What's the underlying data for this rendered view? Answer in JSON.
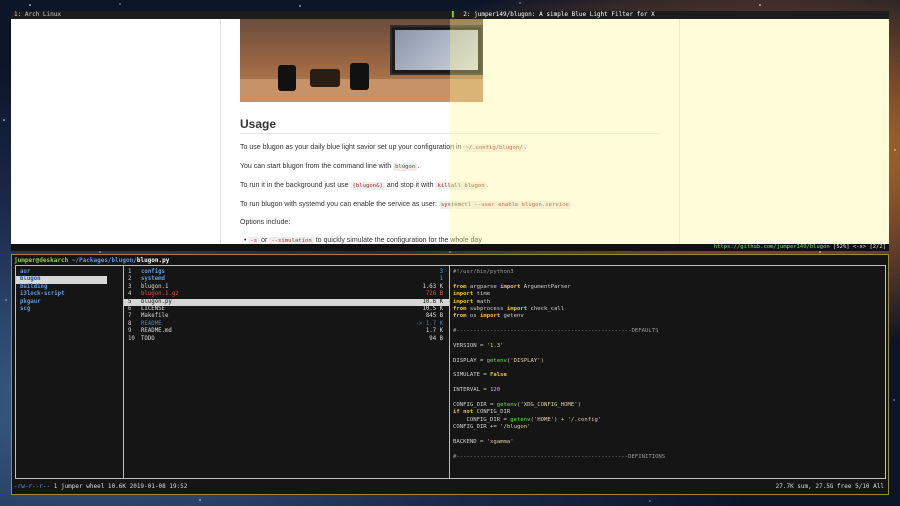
{
  "browser": {
    "tabs": [
      {
        "number": "1:",
        "title": "Arch Linux"
      },
      {
        "number": "2:",
        "title": "jumper149/blugon: A simple Blue Light Filter for X"
      }
    ],
    "page": {
      "heading": "Usage",
      "paragraphs": [
        {
          "text": "To use blugon as your daily blue light savior set up your configuration in",
          "code": "~/.config/blugon/",
          "after": "."
        },
        {
          "text": "You can start blugon from the command line with",
          "code": "blugon",
          "after": "."
        },
        {
          "text": "To run it in the background just use",
          "code": "(blugon&)",
          "after": "and stop it with",
          "code2": "killall blugon",
          "after2": "."
        },
        {
          "text": "To run blugon with systemd you can enable the service as user:",
          "code": "systemctl --user enable blugon.service",
          "after": ""
        },
        {
          "text": "Options include:"
        },
        {
          "bullet": "•",
          "code": "-s",
          "mid": "or",
          "code2": "--simulation",
          "text": "to quickly simulate the configuration for the whole day"
        }
      ]
    },
    "status": {
      "url": "https://github.com/jumper149/blugon",
      "right": "[52%] <-x> [2/2]"
    }
  },
  "terminal": {
    "path": {
      "user": "jumper@deskarch",
      "dir": "~/Packages/blugon/",
      "file": "blugon.py"
    },
    "col1": [
      "aur",
      "blugon",
      "building",
      "i3lock-script",
      "pkgaur",
      "scg"
    ],
    "col1_selected": 1,
    "col2": [
      {
        "num": "1",
        "name": "configs",
        "size": "3",
        "color": "#5f9be0",
        "bold": true
      },
      {
        "num": "2",
        "name": "systemd",
        "size": "1",
        "color": "#5f9be0",
        "bold": true
      },
      {
        "num": "3",
        "name": "blugon.1",
        "size": "1.63 K",
        "color": "#dcdcdc",
        "bold": false
      },
      {
        "num": "4",
        "name": "blugon.1.gz",
        "size": "726 B",
        "color": "#e05050",
        "bold": false
      },
      {
        "num": "5",
        "name": "blugon.py",
        "size": "10.6 K",
        "color": "#111111",
        "bold": false
      },
      {
        "num": "6",
        "name": "LICENSE",
        "size": "10.5 K",
        "color": "#dcdcdc",
        "bold": false
      },
      {
        "num": "7",
        "name": "Makefile",
        "size": "845 B",
        "color": "#dcdcdc",
        "bold": false
      },
      {
        "num": "8",
        "name": "README",
        "size": "-> 1.7 K",
        "color": "#5a7fb0",
        "bold": false
      },
      {
        "num": "9",
        "name": "README.md",
        "size": "1.7 K",
        "color": "#dcdcdc",
        "bold": false
      },
      {
        "num": "10",
        "name": "TODO",
        "size": "94 B",
        "color": "#dcdcdc",
        "bold": false
      }
    ],
    "col2_selected": 4,
    "code": {
      "shebang": "#!/usr/bin/python3",
      "imports": [
        {
          "kw1": "from",
          "mod": " argparse ",
          "kw2": "import",
          "name": " ArgumentParser"
        },
        {
          "kw1": "import",
          "mod": " time",
          "kw2": "",
          "name": ""
        },
        {
          "kw1": "import",
          "mod": " math",
          "kw2": "",
          "name": ""
        },
        {
          "kw1": "from",
          "mod": " subprocess ",
          "kw2": "import",
          "name": " check_call"
        },
        {
          "kw1": "from",
          "mod": " os ",
          "kw2": "import",
          "name": " getenv"
        }
      ],
      "defaults_rule": "#----------------------------------------------------DEFAULTS",
      "version": {
        "name": "VERSION",
        "eq": " = ",
        "value": "'1.3'"
      },
      "display": {
        "name": "DISPLAY",
        "eq": " = ",
        "fn": "getenv",
        "arg": "('DISPLAY')"
      },
      "simulate": {
        "name": "SIMULATE",
        "eq": " = ",
        "value": "False"
      },
      "interval": {
        "name": "INTERVAL",
        "eq": " = ",
        "value": "120"
      },
      "config_dir": {
        "name": "CONFIG_DIR",
        "eq": " = ",
        "fn": "getenv",
        "arg": "('XDG_CONFIG_HOME')"
      },
      "if_line": {
        "kw": "if not",
        "rest": " CONFIG_DIR"
      },
      "config_dir2": {
        "name": "    CONFIG_DIR",
        "eq": " = ",
        "fn": "getenv",
        "arg": "('HOME') + '/.config'"
      },
      "config_dir3": {
        "name": "CONFIG_DIR",
        "eq": " += ",
        "value": "'/blugon'"
      },
      "backend": {
        "name": "BACKEND",
        "eq": " = ",
        "value": "'xgamma'"
      },
      "definitions_rule": "#---------------------------------------------------DEFINITIONS"
    },
    "status_left": {
      "perm": "-rw-r--r--",
      "info": " 1 jumper wheel 10.6K 2019-01-08 19:52"
    },
    "status_right": "27.7K sum, 27.5G free  5/10  All"
  },
  "colors": {
    "accent_green": "#6fe05a",
    "dir_blue": "#5f9be0",
    "border_gold": "#9c8b3a"
  }
}
